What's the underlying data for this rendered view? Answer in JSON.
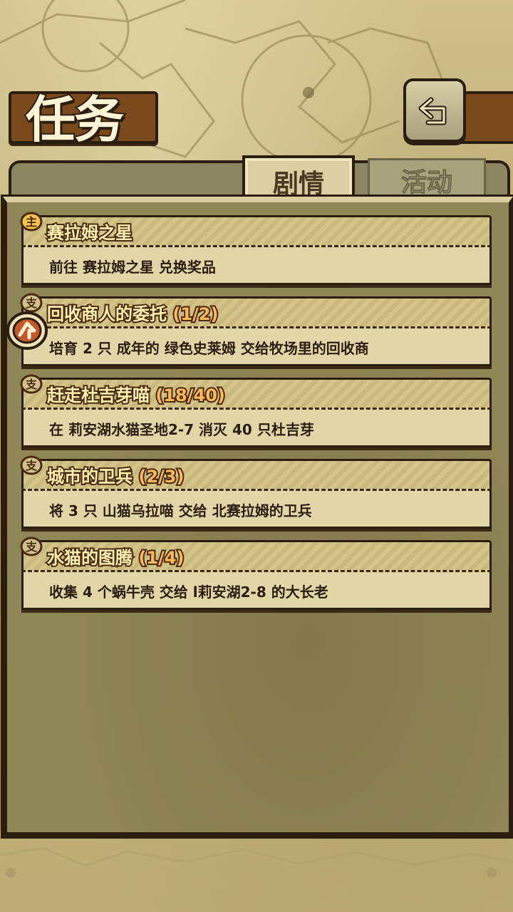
{
  "header": {
    "title": "任务"
  },
  "tabs": [
    {
      "label": "剧情",
      "active": true
    },
    {
      "label": "活动",
      "active": false
    }
  ],
  "quests": [
    {
      "type_icon": "main-quest-icon",
      "type_label": "主",
      "title": "赛拉姆之星",
      "progress": "",
      "description": "前往 赛拉姆之星 兑换奖品"
    },
    {
      "type_icon": "side-quest-icon",
      "type_label": "支",
      "title": "回收商人的委托",
      "progress": "(1/2)",
      "description": "培育 2 只 成年的 绿色史莱姆 交给牧场里的回收商",
      "tracked": true
    },
    {
      "type_icon": "side-quest-icon",
      "type_label": "支",
      "title": "赶走杜吉芽喵",
      "progress": "(18/40)",
      "description": "在 莉安湖水猫圣地2-7 消灭 40 只杜吉芽"
    },
    {
      "type_icon": "side-quest-icon",
      "type_label": "支",
      "title": "城市的卫兵",
      "progress": "(2/3)",
      "description": "将 3 只 山猫乌拉喵 交给 北赛拉姆的卫兵"
    },
    {
      "type_icon": "side-quest-icon",
      "type_label": "支",
      "title": "水猫的图腾",
      "progress": "(1/4)",
      "description": "收集 4 个蜗牛壳 交给 l莉安湖2-8 的大长老"
    }
  ],
  "colors": {
    "frame": "#2b1e10",
    "plaque": "#7a4a1c",
    "card_body": "#e2d6a8",
    "progress_text": "#ffb85a"
  }
}
